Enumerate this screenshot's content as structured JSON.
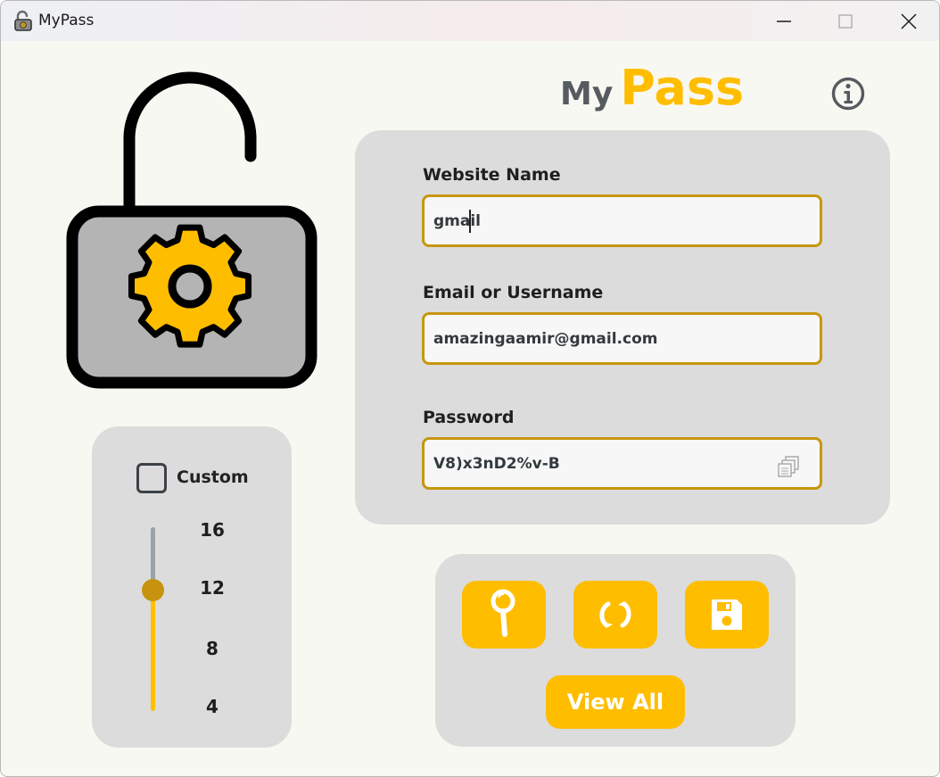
{
  "window": {
    "title": "MyPass"
  },
  "brand": {
    "part1": "My",
    "part2": "Pass",
    "accent_color": "#ffbd00",
    "gray_color": "#555b5f"
  },
  "form": {
    "website": {
      "label": "Website Name",
      "value": "gmail"
    },
    "email": {
      "label": "Email or Username",
      "value": "amazingaamir@gmail.com"
    },
    "password": {
      "label": "Password",
      "value": "V8)x3nD2%v-B"
    }
  },
  "length": {
    "custom_label": "Custom",
    "custom_checked": false,
    "ticks": [
      "16",
      "12",
      "8",
      "4"
    ],
    "slider_value": 12
  },
  "actions": {
    "search_icon": "magnifier-icon",
    "generate_icon": "refresh-icon",
    "save_icon": "floppy-disk-icon",
    "view_all_label": "View All"
  },
  "icons": {
    "app": "lock-icon",
    "info": "info-icon",
    "copy": "copy-icon",
    "minimize": "minimize-icon",
    "maximize": "maximize-icon",
    "close": "close-icon"
  }
}
